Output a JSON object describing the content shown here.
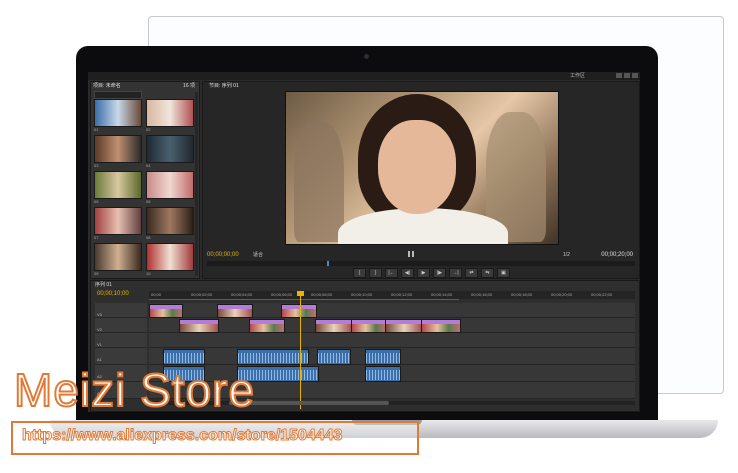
{
  "app": {
    "workspace_label": "工作区",
    "project_panel": {
      "tab": "项目: 未命名",
      "count": "16 项",
      "search_placeholder": "Videos.prproj",
      "clips": [
        {
          "label": "01"
        },
        {
          "label": "02"
        },
        {
          "label": "03"
        },
        {
          "label": "04"
        },
        {
          "label": "05"
        },
        {
          "label": "06"
        },
        {
          "label": "07"
        },
        {
          "label": "08"
        },
        {
          "label": "09"
        },
        {
          "label": "10"
        },
        {
          "label": "11"
        },
        {
          "label": "12"
        }
      ]
    },
    "program_monitor": {
      "tab": "节目: 序列 01",
      "timecode_current": "00;00;00;00",
      "fit": "适合",
      "zoom": "1/2",
      "timecode_duration": "00;00;20;00",
      "transport": [
        "{",
        "}",
        "|←",
        "◀|",
        "▶",
        "|▶",
        "→|",
        "⇄",
        "⇆",
        "▣"
      ]
    },
    "timeline": {
      "tab": "序列 01",
      "timecode": "00;00;10;00",
      "ruler_ticks": [
        "00;00",
        "00;00;02;00",
        "00;00;04;00",
        "00;00;06;00",
        "00;00;08;00",
        "00;00;10;00",
        "00;00;12;00",
        "00;00;14;00",
        "00;00;16;00",
        "00;00;18;00",
        "00;00;20;00",
        "00;00;22;00"
      ],
      "tracks": [
        "V3",
        "V2",
        "V1",
        "A1",
        "A2",
        "A3"
      ]
    }
  },
  "watermark": {
    "brand": "Meizi Store",
    "url": "https://www.aliexpress.com/store/1504443",
    "accent_color": "#e07a36"
  }
}
